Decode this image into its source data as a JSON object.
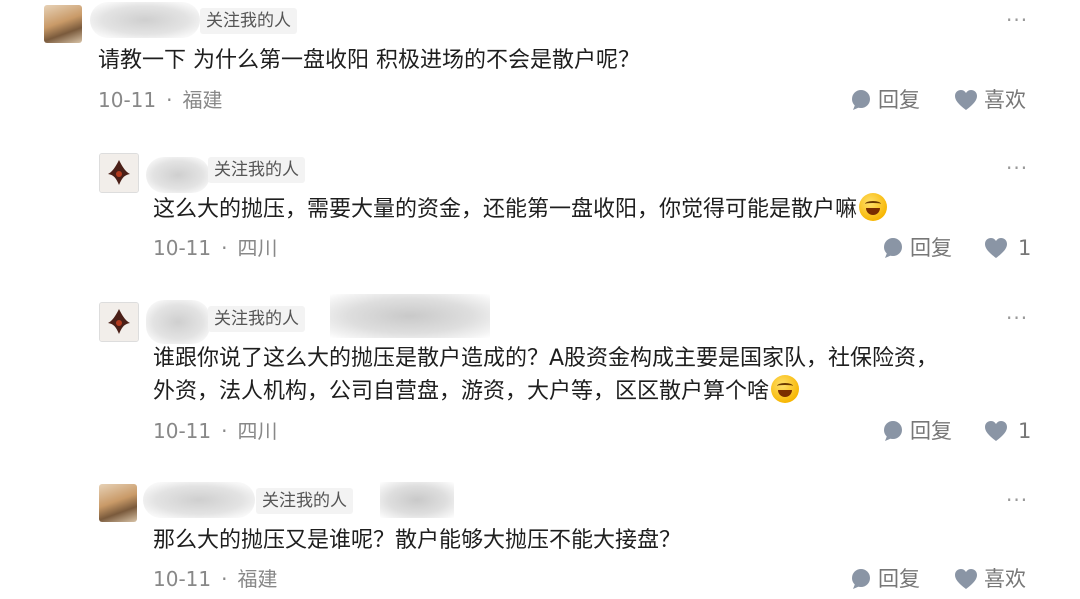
{
  "comments": [
    {
      "follow_tag": "关注我的人",
      "text": "请教一下 为什么第一盘收阳 积极进场的不会是散户呢？",
      "date": "10-11",
      "location": "福建",
      "reply_label": "回复",
      "like_label": "喜欢"
    },
    {
      "follow_tag": "关注我的人",
      "text": "这么大的抛压，需要大量的资金，还能第一盘收阳，你觉得可能是散户嘛",
      "date": "10-11",
      "location": "四川",
      "reply_label": "回复",
      "like_count": "1"
    },
    {
      "follow_tag": "关注我的人",
      "text_line1": "谁跟你说了这么大的抛压是散户造成的？A股资金构成主要是国家队，社保险资，",
      "text_line2": "外资，法人机构，公司自营盘，游资，大户等，区区散户算个啥",
      "date": "10-11",
      "location": "四川",
      "reply_label": "回复",
      "like_count": "1"
    },
    {
      "follow_tag": "关注我的人",
      "text": "那么大的抛压又是谁呢？散户能够大抛压不能大接盘？",
      "date": "10-11",
      "location": "福建",
      "reply_label": "回复",
      "like_label": "喜欢"
    }
  ],
  "icons": {
    "reply": "chat-bubble-icon",
    "like": "heart-icon",
    "more": "more-dots-icon",
    "emoji": "rolling-laughing-emoji"
  },
  "colors": {
    "meta": "#888888",
    "tag_bg": "#f3f3f3",
    "icon": "#8a95a5"
  }
}
